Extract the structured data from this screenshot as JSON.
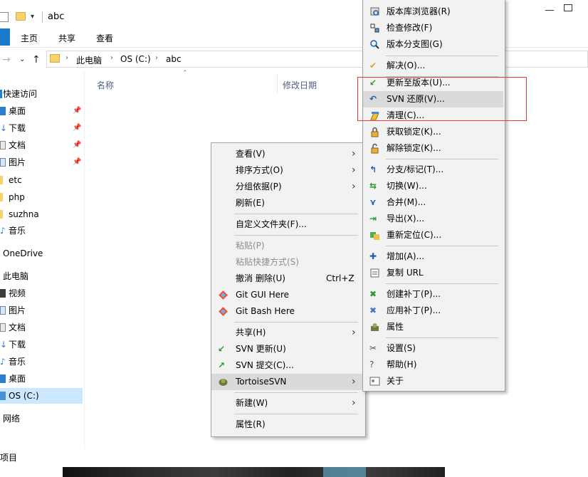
{
  "window": {
    "title": "abc"
  },
  "ribbon": {
    "tabs": [
      "主页",
      "共享",
      "查看"
    ]
  },
  "address": {
    "crumbs": [
      "此电脑",
      "OS (C:)",
      "abc"
    ]
  },
  "nav_pane": {
    "items": [
      {
        "label": "快速访问"
      },
      {
        "label": "桌面"
      },
      {
        "label": "下载"
      },
      {
        "label": "文档"
      },
      {
        "label": "图片"
      },
      {
        "label": "etc"
      },
      {
        "label": "php"
      },
      {
        "label": "suzhna"
      },
      {
        "label": "音乐"
      },
      {
        "label": "OneDrive"
      },
      {
        "label": "此电脑"
      },
      {
        "label": "视频"
      },
      {
        "label": "图片"
      },
      {
        "label": "文档"
      },
      {
        "label": "下载"
      },
      {
        "label": "音乐"
      },
      {
        "label": "桌面"
      },
      {
        "label": "OS (C:)"
      },
      {
        "label": "网络"
      }
    ]
  },
  "columns": {
    "name": "名称",
    "date": "修改日期"
  },
  "status": {
    "text": "项目"
  },
  "context_menu": {
    "items": [
      {
        "label": "查看(V)"
      },
      {
        "label": "排序方式(O)"
      },
      {
        "label": "分组依据(P)"
      },
      {
        "label": "刷新(E)"
      },
      {
        "label": "自定义文件夹(F)..."
      },
      {
        "label": "粘贴(P)"
      },
      {
        "label": "粘贴快捷方式(S)"
      },
      {
        "label": "撤消 删除(U)",
        "shortcut": "Ctrl+Z"
      },
      {
        "label": "Git GUI Here"
      },
      {
        "label": "Git Bash Here"
      },
      {
        "label": "共享(H)"
      },
      {
        "label": "SVN 更新(U)"
      },
      {
        "label": "SVN 提交(C)..."
      },
      {
        "label": "TortoiseSVN"
      },
      {
        "label": "新建(W)"
      },
      {
        "label": "属性(R)"
      }
    ]
  },
  "svn_menu": {
    "items": [
      {
        "label": "版本库浏览器(R)"
      },
      {
        "label": "检查修改(F)"
      },
      {
        "label": "版本分支图(G)"
      },
      {
        "label": "解决(O)..."
      },
      {
        "label": "更新至版本(U)..."
      },
      {
        "label": "SVN 还原(V)..."
      },
      {
        "label": "清理(C)..."
      },
      {
        "label": "获取锁定(K)..."
      },
      {
        "label": "解除锁定(K)..."
      },
      {
        "label": "分支/标记(T)..."
      },
      {
        "label": "切换(W)..."
      },
      {
        "label": "合并(M)..."
      },
      {
        "label": "导出(X)..."
      },
      {
        "label": "重新定位(C)..."
      },
      {
        "label": "增加(A)..."
      },
      {
        "label": "复制 URL"
      },
      {
        "label": "创建补丁(P)..."
      },
      {
        "label": "应用补丁(P)..."
      },
      {
        "label": "属性"
      },
      {
        "label": "设置(S)"
      },
      {
        "label": "帮助(H)"
      },
      {
        "label": "关于"
      }
    ]
  },
  "colors": {
    "accent": "#1979ca",
    "menu_bg": "#f2f2f2",
    "menu_highlight": "#dadada",
    "selection": "#cce8ff",
    "annotation_box": "#e23a2f"
  }
}
